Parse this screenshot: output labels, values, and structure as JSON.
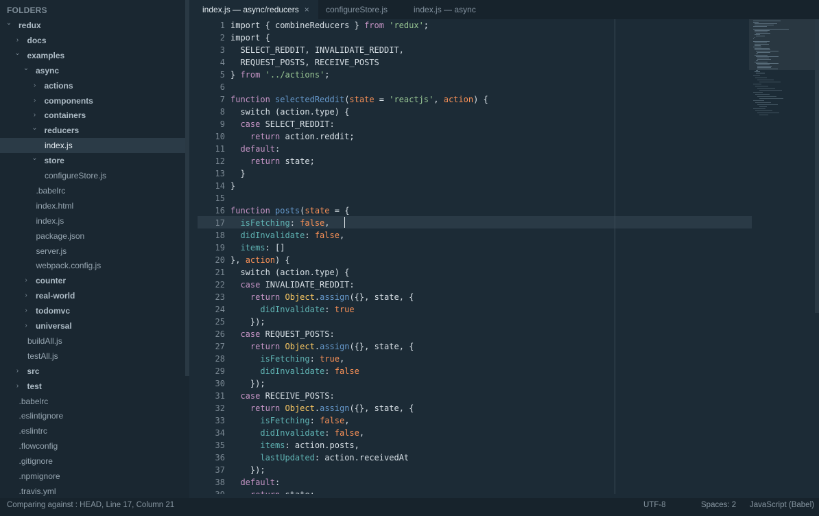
{
  "sidebar": {
    "title": "FOLDERS",
    "items": [
      {
        "label": "redux",
        "type": "folder",
        "open": true,
        "depth": 0
      },
      {
        "label": "docs",
        "type": "folder",
        "open": false,
        "depth": 1
      },
      {
        "label": "examples",
        "type": "folder",
        "open": true,
        "depth": 1
      },
      {
        "label": "async",
        "type": "folder",
        "open": true,
        "depth": 2
      },
      {
        "label": "actions",
        "type": "folder",
        "open": false,
        "depth": 3
      },
      {
        "label": "components",
        "type": "folder",
        "open": false,
        "depth": 3
      },
      {
        "label": "containers",
        "type": "folder",
        "open": false,
        "depth": 3
      },
      {
        "label": "reducers",
        "type": "folder",
        "open": true,
        "depth": 3
      },
      {
        "label": "index.js",
        "type": "file",
        "depth": 4,
        "selected": true
      },
      {
        "label": "store",
        "type": "folder",
        "open": true,
        "depth": 3
      },
      {
        "label": "configureStore.js",
        "type": "file",
        "depth": 4
      },
      {
        "label": ".babelrc",
        "type": "file",
        "depth": 3
      },
      {
        "label": "index.html",
        "type": "file",
        "depth": 3
      },
      {
        "label": "index.js",
        "type": "file",
        "depth": 3
      },
      {
        "label": "package.json",
        "type": "file",
        "depth": 3
      },
      {
        "label": "server.js",
        "type": "file",
        "depth": 3
      },
      {
        "label": "webpack.config.js",
        "type": "file",
        "depth": 3
      },
      {
        "label": "counter",
        "type": "folder",
        "open": false,
        "depth": 2
      },
      {
        "label": "real-world",
        "type": "folder",
        "open": false,
        "depth": 2
      },
      {
        "label": "todomvc",
        "type": "folder",
        "open": false,
        "depth": 2
      },
      {
        "label": "universal",
        "type": "folder",
        "open": false,
        "depth": 2
      },
      {
        "label": "buildAll.js",
        "type": "file",
        "depth": 2
      },
      {
        "label": "testAll.js",
        "type": "file",
        "depth": 2
      },
      {
        "label": "src",
        "type": "folder",
        "open": false,
        "depth": 1
      },
      {
        "label": "test",
        "type": "folder",
        "open": false,
        "depth": 1
      },
      {
        "label": ".babelrc",
        "type": "file",
        "depth": 1
      },
      {
        "label": ".eslintignore",
        "type": "file",
        "depth": 1
      },
      {
        "label": ".eslintrc",
        "type": "file",
        "depth": 1
      },
      {
        "label": ".flowconfig",
        "type": "file",
        "depth": 1
      },
      {
        "label": ".gitignore",
        "type": "file",
        "depth": 1
      },
      {
        "label": ".npmignore",
        "type": "file",
        "depth": 1
      },
      {
        "label": ".travis.yml",
        "type": "file",
        "depth": 1
      }
    ]
  },
  "tabs": [
    {
      "label": "index.js — async/reducers",
      "active": true,
      "close": "×"
    },
    {
      "label": "configureStore.js",
      "active": false
    },
    {
      "label": "index.js — async",
      "active": false
    }
  ],
  "editor": {
    "first_line": 1,
    "current_line": 17,
    "lines": [
      [
        [
          "import { combineReducers } ",
          "pl"
        ],
        [
          "from",
          "kw"
        ],
        [
          " ",
          "pl"
        ],
        [
          "'redux'",
          "st"
        ],
        [
          ";",
          "pl"
        ]
      ],
      [
        [
          "import {",
          "pl"
        ]
      ],
      [
        [
          "  SELECT_REDDIT, INVALIDATE_REDDIT,",
          "pl"
        ]
      ],
      [
        [
          "  REQUEST_POSTS, RECEIVE_POSTS",
          "pl"
        ]
      ],
      [
        [
          "} ",
          "pl"
        ],
        [
          "from",
          "kw"
        ],
        [
          " ",
          "pl"
        ],
        [
          "'../actions'",
          "st"
        ],
        [
          ";",
          "pl"
        ]
      ],
      [],
      [
        [
          "function",
          "kw"
        ],
        [
          " ",
          "pl"
        ],
        [
          "selectedReddit",
          "fn"
        ],
        [
          "(",
          "pl"
        ],
        [
          "state",
          "pa"
        ],
        [
          " = ",
          "pl"
        ],
        [
          "'reactjs'",
          "st"
        ],
        [
          ", ",
          "pl"
        ],
        [
          "action",
          "pa"
        ],
        [
          ") {",
          "pl"
        ]
      ],
      [
        [
          "  switch (action.type) {",
          "pl"
        ]
      ],
      [
        [
          "  ",
          "pl"
        ],
        [
          "case",
          "kw"
        ],
        [
          " SELECT_REDDIT:",
          "pl"
        ]
      ],
      [
        [
          "    ",
          "pl"
        ],
        [
          "return",
          "kw"
        ],
        [
          " action.reddit;",
          "pl"
        ]
      ],
      [
        [
          "  ",
          "pl"
        ],
        [
          "default",
          "kw"
        ],
        [
          ":",
          "pl"
        ]
      ],
      [
        [
          "    ",
          "pl"
        ],
        [
          "return",
          "kw"
        ],
        [
          " state;",
          "pl"
        ]
      ],
      [
        [
          "  }",
          "pl"
        ]
      ],
      [
        [
          "}",
          "pl"
        ]
      ],
      [],
      [
        [
          "function",
          "kw"
        ],
        [
          " ",
          "pl"
        ],
        [
          "posts",
          "fn"
        ],
        [
          "(",
          "pl"
        ],
        [
          "state",
          "pa"
        ],
        [
          " = {",
          "pl"
        ]
      ],
      [
        [
          "  ",
          "pl"
        ],
        [
          "isFetching",
          "prop"
        ],
        [
          ": ",
          "pl"
        ],
        [
          "false",
          "bool"
        ],
        [
          ",",
          "pl"
        ]
      ],
      [
        [
          "  ",
          "pl"
        ],
        [
          "didInvalidate",
          "prop"
        ],
        [
          ": ",
          "pl"
        ],
        [
          "false",
          "bool"
        ],
        [
          ",",
          "pl"
        ]
      ],
      [
        [
          "  ",
          "pl"
        ],
        [
          "items",
          "prop"
        ],
        [
          ": []",
          "pl"
        ]
      ],
      [
        [
          "}, ",
          "pl"
        ],
        [
          "action",
          "pa"
        ],
        [
          ") {",
          "pl"
        ]
      ],
      [
        [
          "  switch (action.type) {",
          "pl"
        ]
      ],
      [
        [
          "  ",
          "pl"
        ],
        [
          "case",
          "kw"
        ],
        [
          " INVALIDATE_REDDIT:",
          "pl"
        ]
      ],
      [
        [
          "    ",
          "pl"
        ],
        [
          "return",
          "kw"
        ],
        [
          " ",
          "pl"
        ],
        [
          "Object",
          "obj"
        ],
        [
          ".",
          "pl"
        ],
        [
          "assign",
          "fn"
        ],
        [
          "({}, state, {",
          "pl"
        ]
      ],
      [
        [
          "      ",
          "pl"
        ],
        [
          "didInvalidate",
          "prop"
        ],
        [
          ": ",
          "pl"
        ],
        [
          "true",
          "bool"
        ]
      ],
      [
        [
          "    });",
          "pl"
        ]
      ],
      [
        [
          "  ",
          "pl"
        ],
        [
          "case",
          "kw"
        ],
        [
          " REQUEST_POSTS:",
          "pl"
        ]
      ],
      [
        [
          "    ",
          "pl"
        ],
        [
          "return",
          "kw"
        ],
        [
          " ",
          "pl"
        ],
        [
          "Object",
          "obj"
        ],
        [
          ".",
          "pl"
        ],
        [
          "assign",
          "fn"
        ],
        [
          "({}, state, {",
          "pl"
        ]
      ],
      [
        [
          "      ",
          "pl"
        ],
        [
          "isFetching",
          "prop"
        ],
        [
          ": ",
          "pl"
        ],
        [
          "true",
          "bool"
        ],
        [
          ",",
          "pl"
        ]
      ],
      [
        [
          "      ",
          "pl"
        ],
        [
          "didInvalidate",
          "prop"
        ],
        [
          ": ",
          "pl"
        ],
        [
          "false",
          "bool"
        ]
      ],
      [
        [
          "    });",
          "pl"
        ]
      ],
      [
        [
          "  ",
          "pl"
        ],
        [
          "case",
          "kw"
        ],
        [
          " RECEIVE_POSTS:",
          "pl"
        ]
      ],
      [
        [
          "    ",
          "pl"
        ],
        [
          "return",
          "kw"
        ],
        [
          " ",
          "pl"
        ],
        [
          "Object",
          "obj"
        ],
        [
          ".",
          "pl"
        ],
        [
          "assign",
          "fn"
        ],
        [
          "({}, state, {",
          "pl"
        ]
      ],
      [
        [
          "      ",
          "pl"
        ],
        [
          "isFetching",
          "prop"
        ],
        [
          ": ",
          "pl"
        ],
        [
          "false",
          "bool"
        ],
        [
          ",",
          "pl"
        ]
      ],
      [
        [
          "      ",
          "pl"
        ],
        [
          "didInvalidate",
          "prop"
        ],
        [
          ": ",
          "pl"
        ],
        [
          "false",
          "bool"
        ],
        [
          ",",
          "pl"
        ]
      ],
      [
        [
          "      ",
          "pl"
        ],
        [
          "items",
          "prop"
        ],
        [
          ": action.posts,",
          "pl"
        ]
      ],
      [
        [
          "      ",
          "pl"
        ],
        [
          "lastUpdated",
          "prop"
        ],
        [
          ": action.receivedAt",
          "pl"
        ]
      ],
      [
        [
          "    });",
          "pl"
        ]
      ],
      [
        [
          "  ",
          "pl"
        ],
        [
          "default",
          "kw"
        ],
        [
          ":",
          "pl"
        ]
      ],
      [
        [
          "    ",
          "pl"
        ],
        [
          "return",
          "kw"
        ],
        [
          " state;",
          "pl"
        ]
      ]
    ]
  },
  "statusbar": {
    "left": "Comparing against : HEAD, Line 17, Column 21",
    "encoding": "UTF-8",
    "indent": "Spaces: 2",
    "syntax": "JavaScript (Babel)"
  },
  "colors": {
    "background": "#1c2b36",
    "sidebar": "#1a2731",
    "keyword": "#c594c5",
    "function": "#6699cc",
    "string": "#99c794",
    "param": "#f99157",
    "property": "#5fb3b3",
    "builtin": "#fac863"
  }
}
